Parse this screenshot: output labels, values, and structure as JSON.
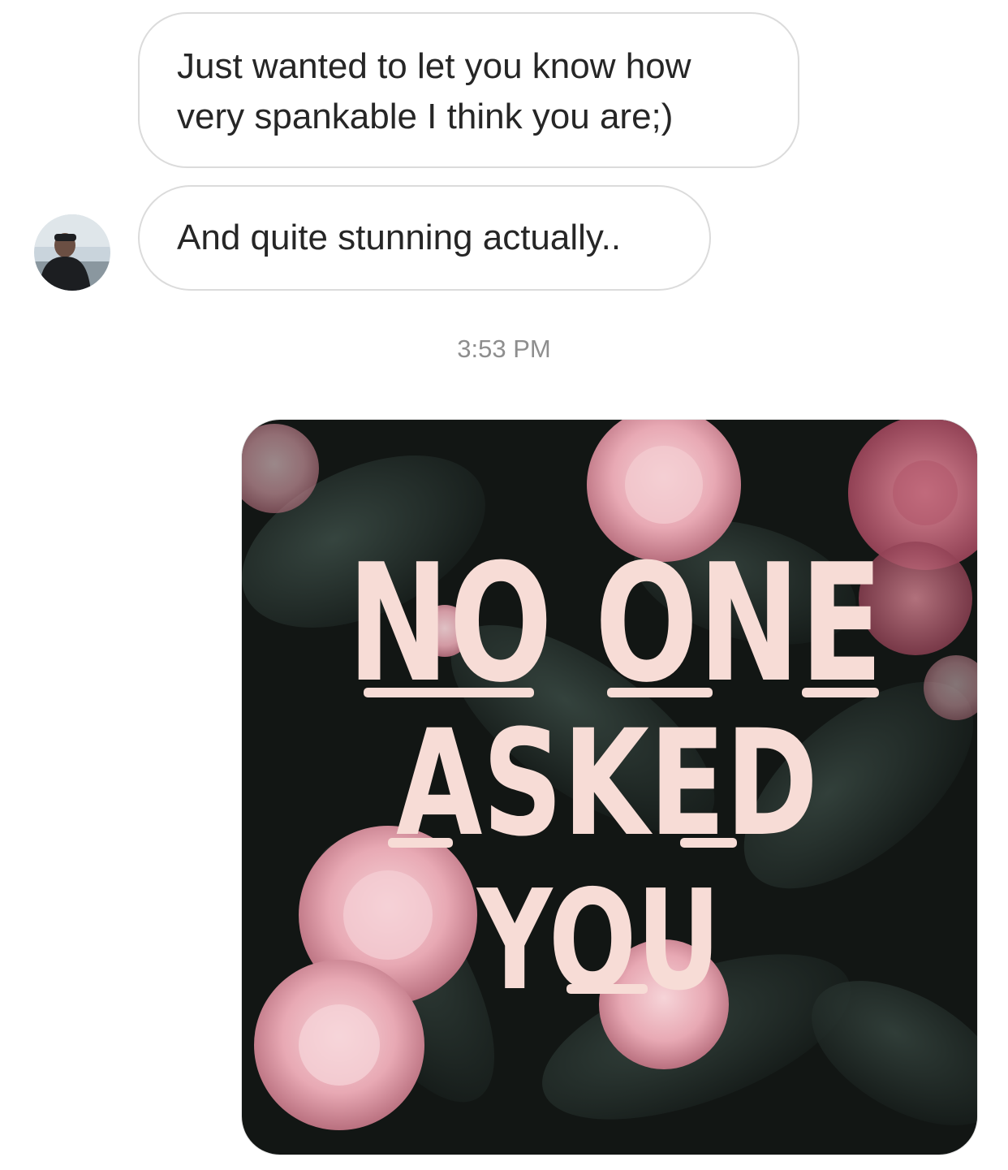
{
  "thread": {
    "messages": [
      {
        "text": "Just wanted to let you know how very spankable I think you are;)"
      },
      {
        "text": "And quite stunning actually.."
      }
    ],
    "timestamp": "3:53 PM",
    "image_message": {
      "lines": [
        "NO ONE",
        "ASKED",
        "YOU"
      ]
    }
  },
  "colors": {
    "bubble_border": "#dbdbdb",
    "text": "#262626",
    "timestamp": "#8e8e8e",
    "image_text": "#f7dcd6",
    "image_bg": "#121614"
  }
}
